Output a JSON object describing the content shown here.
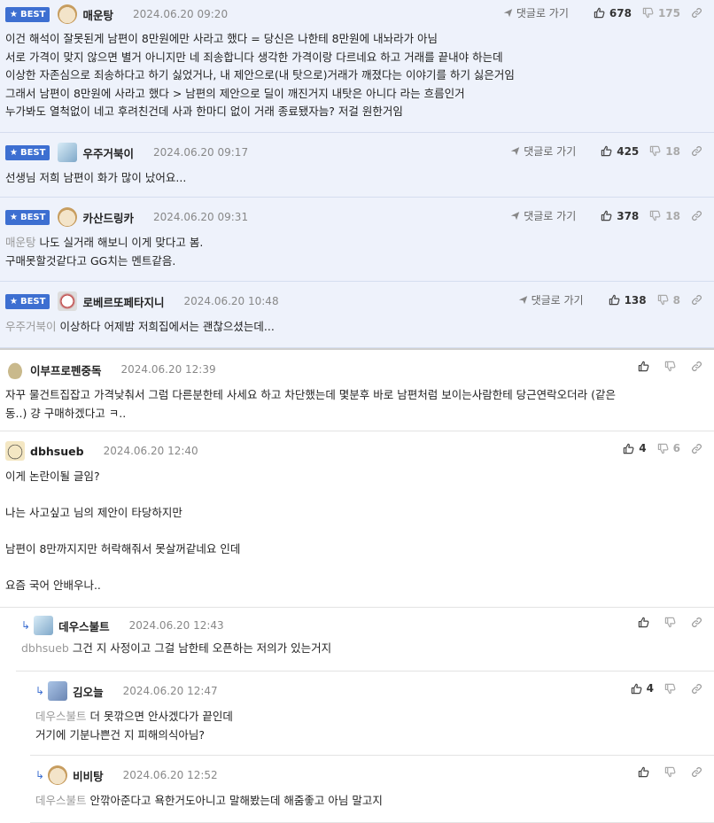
{
  "labels": {
    "best": "BEST",
    "reply_to": "댓글로 가기"
  },
  "comments": [
    {
      "nick": "매운탕",
      "time": "2024.06.20 09:20",
      "up": "678",
      "down": "175",
      "lines": [
        "이건 해석이 잘못된게 남편이 8만원에만 사라고 했다 = 당신은 나한테 8만원에 내놔라가 아님",
        "서로 가격이 맞지 않으면 별거 아니지만 네 죄송합니다 생각한 가격이랑 다르네요 하고 거래를 끝내야 하는데",
        "이상한 자존심으로 죄송하다고 하기 싫었거나, 내 제안으로(내 탓으로)거래가 깨졌다는 이야기를 하기 싫은거임",
        "그래서 남편이 8만원에 사라고 했다 > 남편의 제안으로 딜이 깨진거지 내탓은 아니다 라는 흐름인거",
        "누가봐도 열척없이 네고 후려친건데 사과 한마디 없이 거래 종료됐자늠? 저걸 원한거임"
      ]
    },
    {
      "nick": "우주거북이",
      "time": "2024.06.20 09:17",
      "up": "425",
      "down": "18",
      "lines": [
        "선생님 저희 남편이 화가 많이 났어요..."
      ]
    },
    {
      "nick": "카산드링카",
      "time": "2024.06.20 09:31",
      "up": "378",
      "down": "18",
      "mention": "매운탕",
      "lines": [
        "나도 실거래 해보니 이게 맞다고 봄.",
        "구매못할것같다고 GG치는 멘트같음."
      ]
    },
    {
      "nick": "로베르또페타지니",
      "time": "2024.06.20 10:48",
      "up": "138",
      "down": "8",
      "mention": "우주거북이",
      "lines": [
        "이상하다 어제밤 저희집에서는 괜찮으셨는데..."
      ]
    },
    {
      "nick": "이부프로펜중독",
      "time": "2024.06.20 12:39",
      "lines": [
        "자꾸 물건트집잡고 가격낮춰서 그럼 다른분한테 사세요 하고 차단했는데 몇분후 바로 남편처럼 보이는사람한테 당근연락오더라 (같은",
        "동..) 걍 구매하겠다고 ㅋ.."
      ]
    },
    {
      "nick": "dbhsueb",
      "time": "2024.06.20 12:40",
      "up": "4",
      "down": "6",
      "lines": [
        "이게 논란이될 글임?",
        "",
        "나는 사고싶고 님의 제안이 타당하지만",
        "",
        "남편이 8만까지지만 허락해줘서 못살꺼같네요 인데",
        "",
        "요즘 국어 안배우나.."
      ]
    },
    {
      "nick": "데우스불트",
      "time": "2024.06.20 12:43",
      "mention": "dbhsueb",
      "lines": [
        "그건 지 사정이고 그걸 남한테 오픈하는 저의가 있는거지"
      ]
    },
    {
      "nick": "김오늘",
      "time": "2024.06.20 12:47",
      "up": "4",
      "mention": "데우스불트",
      "lines": [
        "더 못깎으면 안사겠다가 끝인데",
        "거기에 기분나쁜건 지 피해의식아님?"
      ]
    },
    {
      "nick": "비비탕",
      "time": "2024.06.20 12:52",
      "mention": "데우스불트",
      "lines": [
        "안깎아준다고 욕한거도아니고 말해봤는데 해줌좋고 아님 말고지"
      ]
    }
  ]
}
